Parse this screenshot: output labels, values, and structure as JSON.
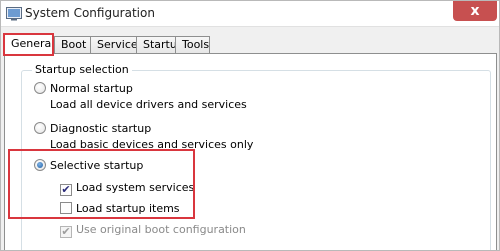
{
  "window": {
    "title": "System Configuration",
    "close_glyph": "x",
    "highlight_color": "#d9363e"
  },
  "tabs": [
    {
      "label": "General",
      "active": true
    },
    {
      "label": "Boot",
      "active": false
    },
    {
      "label": "Services",
      "active": false
    },
    {
      "label": "Startup",
      "active": false
    },
    {
      "label": "Tools",
      "active": false
    }
  ],
  "startup_selection": {
    "title": "Startup selection",
    "normal": {
      "label": "Normal startup",
      "description": "Load all device drivers and services",
      "selected": false
    },
    "diagnostic": {
      "label": "Diagnostic startup",
      "description": "Load basic devices and services only",
      "selected": false
    },
    "selective": {
      "label": "Selective startup",
      "selected": true,
      "options": {
        "system_services": {
          "label": "Load system services",
          "checked": true
        },
        "startup_items": {
          "label": "Load startup items",
          "checked": false
        },
        "original_boot": {
          "label": "Use original boot configuration",
          "checked": true,
          "disabled": true
        }
      }
    }
  },
  "icons": {
    "app": "system-configuration-icon",
    "close": "close-icon",
    "check": "✔"
  }
}
